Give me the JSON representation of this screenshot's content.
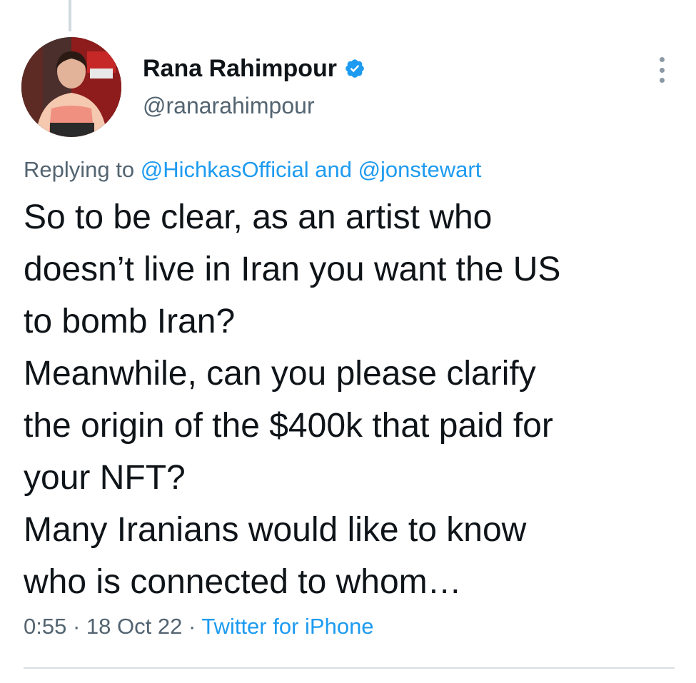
{
  "tweet": {
    "author": {
      "display_name": "Rana Rahimpour",
      "handle": "@ranarahimpour",
      "verified": true,
      "avatar_icon": "profile-photo"
    },
    "more_icon": "more-options-icon",
    "reply": {
      "prefix": "Replying to ",
      "mention_1": "@HichkasOfficial",
      "joiner": " and ",
      "mention_2": "@jonstewart"
    },
    "text_lines": [
      "So to be clear, as an artist who",
      "doesn’t live in Iran you want the US",
      "to bomb Iran?",
      "Meanwhile, can you please clarify",
      "the origin of the $400k that paid for",
      "your NFT?",
      "Many Iranians would like to know",
      "who is connected to whom…"
    ],
    "meta": {
      "time": "0:55",
      "separator": " · ",
      "date": "18 Oct 22",
      "source": "Twitter for iPhone"
    }
  },
  "colors": {
    "text": "#0f1419",
    "secondary": "#536471",
    "accent": "#1d9bf0"
  }
}
